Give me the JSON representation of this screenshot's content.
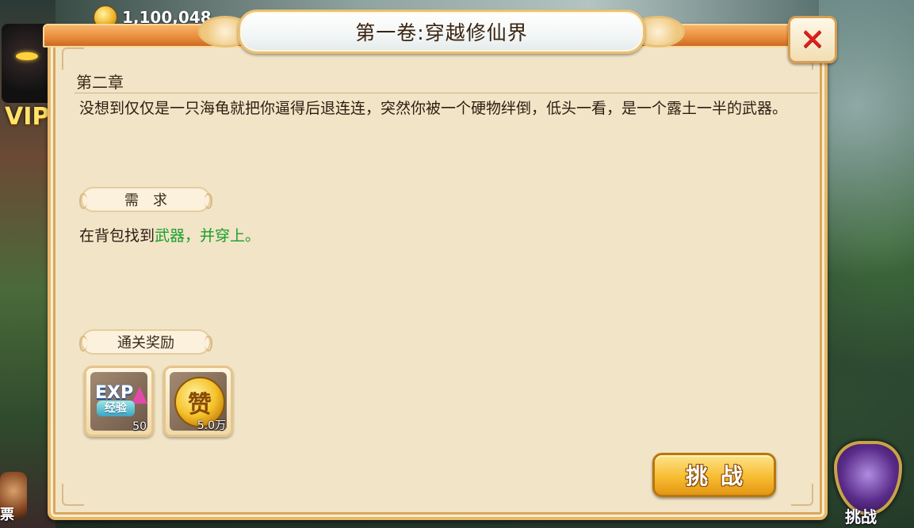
{
  "hud": {
    "gold_amount": "1,100,048",
    "vip_label": "VIP",
    "left_bottom_label": "票",
    "side_challenge_label": "挑战"
  },
  "dialog": {
    "title": "第一卷:穿越修仙界",
    "close_glyph": "✕",
    "chapter": "第二章",
    "story": "没想到仅仅是一只海龟就把你逼得后退连连，突然你被一个硬物绊倒，低头一看，是一个露土一半的武器。",
    "requirement_tab": "需求",
    "requirement": {
      "prefix": "在背包找到",
      "highlight": "武器，并穿上。",
      "highlight_color": "#16a02a"
    },
    "reward_tab": "通关奖励",
    "rewards": [
      {
        "icon": "exp-icon",
        "word": "EXP",
        "cn": "经验",
        "quantity": "50"
      },
      {
        "icon": "gold-coin-icon",
        "glyph": "赞",
        "quantity": "5.0万"
      }
    ],
    "challenge_button": "挑战"
  },
  "colors": {
    "panel": "#f2e4c6",
    "frame_orange": "#e98b3a",
    "close_red": "#e0201a",
    "button_gold": "#f7bd32"
  }
}
